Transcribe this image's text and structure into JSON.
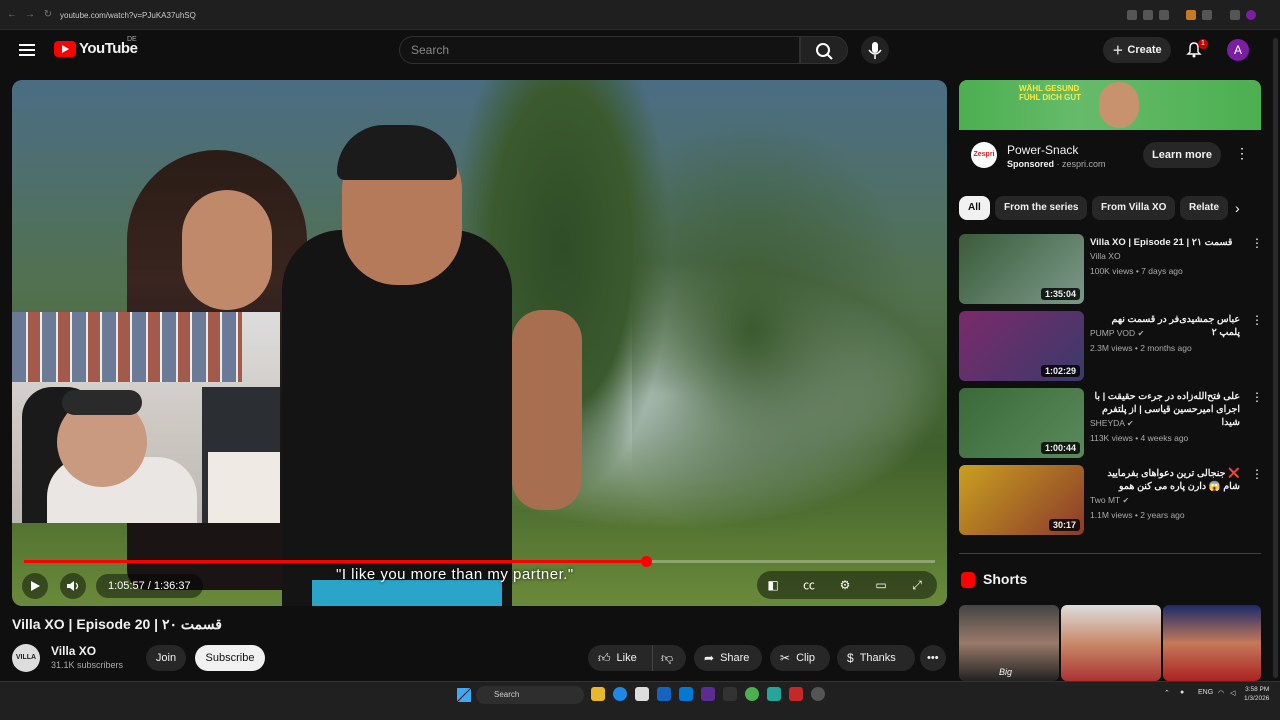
{
  "browser": {
    "url": "youtube.com/watch?v=PJuKA37uhSQ"
  },
  "header": {
    "logo_text": "YouTube",
    "country_code": "DE",
    "search_placeholder": "Search",
    "create_label": "Create",
    "notification_count": "1",
    "avatar_letter": "A"
  },
  "player": {
    "subtitle": "\"I like you more than my partner.\"",
    "current_time": "1:05:57",
    "duration": "1:36:37",
    "time_display": "1:05:57 / 1:36:37",
    "progress": 0.6826,
    "accent": "#ff0000"
  },
  "video": {
    "title": "Villa XO | Episode 20 | قسمت ۲۰",
    "channel": "Villa XO",
    "channel_avatar_text": "VILLA",
    "subscribers": "31.1K subscribers",
    "join_label": "Join",
    "subscribe_label": "Subscribe",
    "actions": {
      "like": "Like",
      "share": "Share",
      "clip": "Clip",
      "thanks": "Thanks"
    }
  },
  "ad": {
    "banner_text": "WÄHL GESUND FÜHL DICH GUT",
    "logo_text": "Zespri",
    "title": "Power-Snack",
    "sponsored": "Sponsored",
    "domain": "zespri.com",
    "cta": "Learn more"
  },
  "chips": [
    "All",
    "From the series",
    "From Villa XO",
    "Relate"
  ],
  "recommendations": [
    {
      "title": "Villa XO | Episode 21 | قسمت ۲۱",
      "channel": "Villa XO",
      "verified": false,
      "views": "100K views",
      "age": "7 days ago",
      "duration": "1:35:04",
      "thumb_colors": [
        "#3b5b3a",
        "#7a9a8a"
      ]
    },
    {
      "title": "عباس جمشیدی‌فر در قسمت نهم پلمپ ۲",
      "channel": "PUMP VOD",
      "verified": true,
      "views": "2.3M views",
      "age": "2 months ago",
      "duration": "1:02:29",
      "thumb_colors": [
        "#7b2a6b",
        "#3a3a6a"
      ]
    },
    {
      "title": "علی فتح‌الله‌زاده در جرءت حقیقت | با اجرای امیرحسین قیاسی | از پلتفرم شیدا",
      "channel": "SHEYDA",
      "verified": true,
      "views": "113K views",
      "age": "4 weeks ago",
      "duration": "1:00:44",
      "thumb_colors": [
        "#3a6a3a",
        "#5a8a5a"
      ]
    },
    {
      "title": "❌ جنجالی ترین دعواهای بفرمایید شام 😱 دارن پاره می کنن همو",
      "channel": "Two MT",
      "verified": true,
      "views": "1.1M views",
      "age": "2 years ago",
      "duration": "30:17",
      "thumb_colors": [
        "#c9a020",
        "#8a3a2a"
      ]
    }
  ],
  "shorts": {
    "label": "Shorts",
    "items": [
      {
        "caption": "Big"
      },
      {
        "caption": ""
      },
      {
        "caption": ""
      }
    ]
  },
  "taskbar": {
    "search_label": "Search",
    "language": "ENG",
    "time": "3:58 PM",
    "date": "1/3/2026"
  }
}
